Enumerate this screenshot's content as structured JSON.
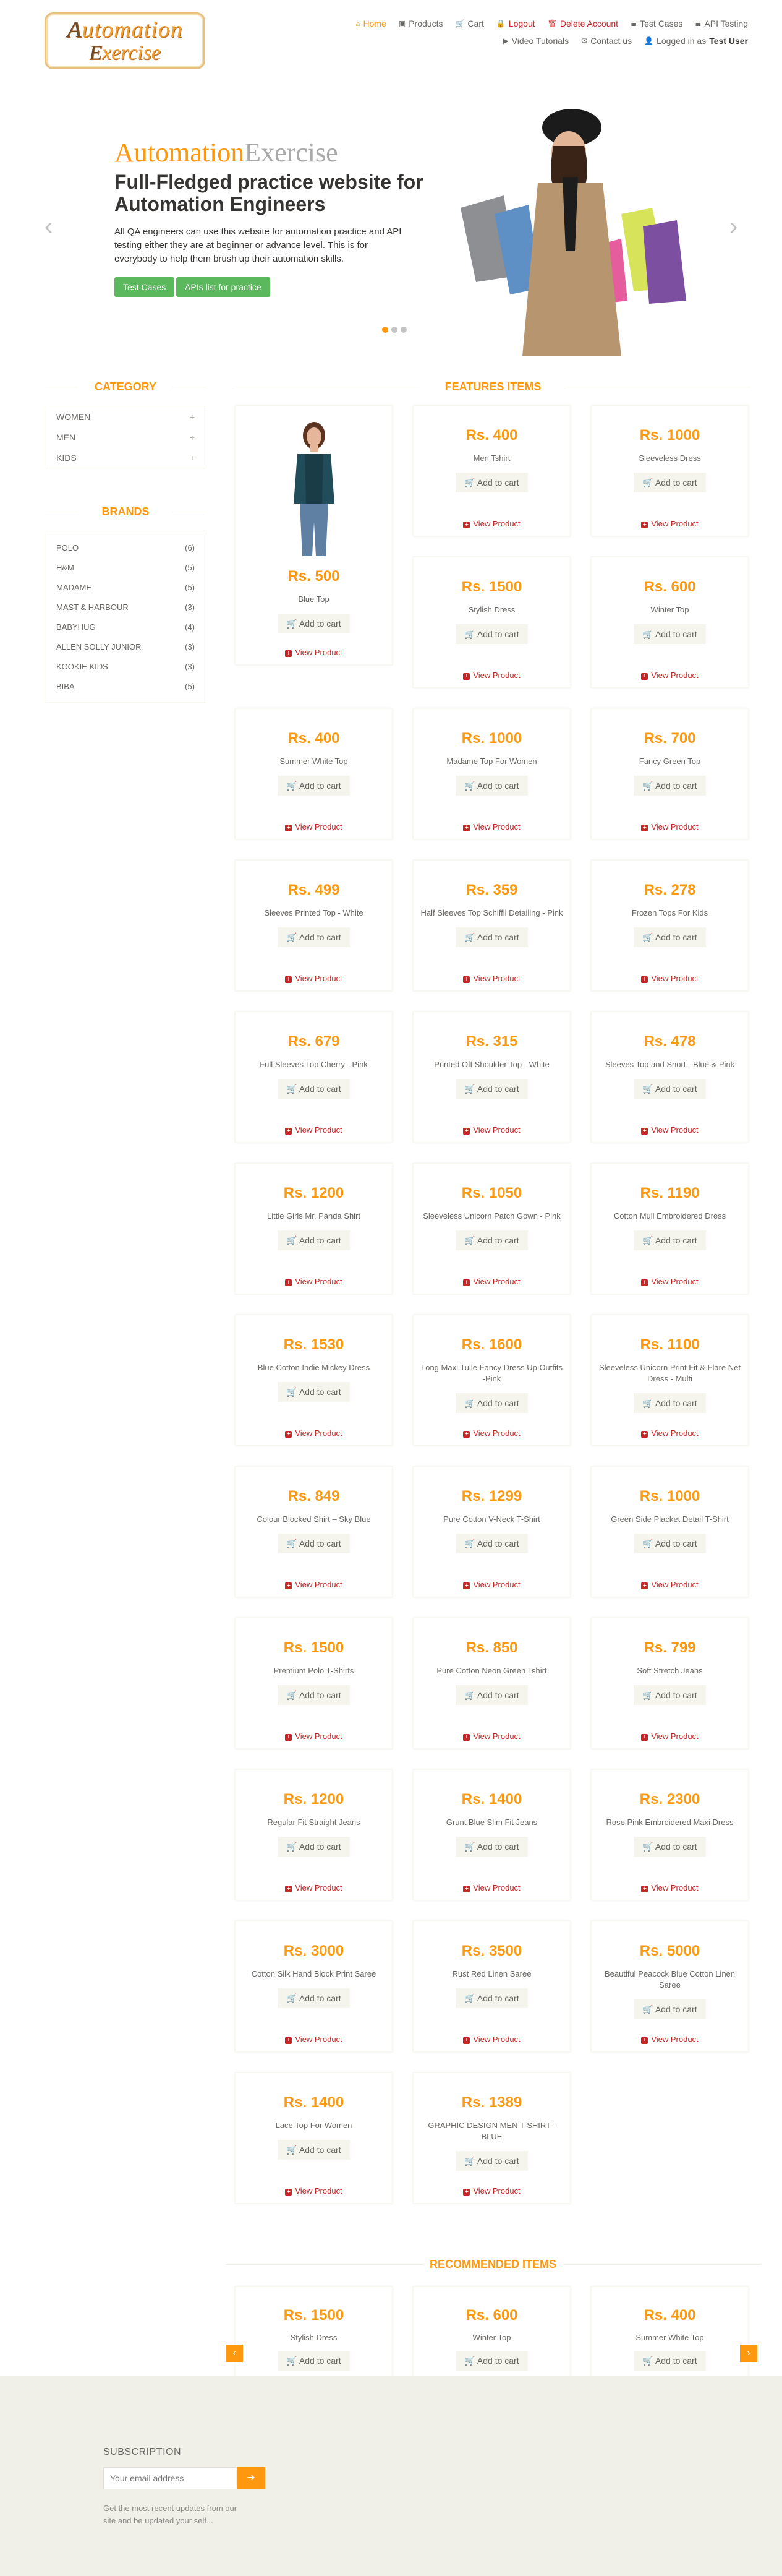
{
  "logo": {
    "line1_a": "Automation",
    "line2_a": "Exercise"
  },
  "nav": [
    {
      "label": "Home",
      "icon": "home-icon",
      "glyph": "⌂",
      "style": "active"
    },
    {
      "label": "Products",
      "icon": "products-icon",
      "glyph": "▣",
      "style": ""
    },
    {
      "label": "Cart",
      "icon": "cart-icon",
      "glyph": "🛒",
      "style": ""
    },
    {
      "label": "Logout",
      "icon": "lock-icon",
      "glyph": "🔒",
      "style": "danger"
    },
    {
      "label": "Delete Account",
      "icon": "trash-icon",
      "glyph": "🗑",
      "style": "danger"
    },
    {
      "label": "Test Cases",
      "icon": "list-icon",
      "glyph": "≣",
      "style": ""
    },
    {
      "label": "API Testing",
      "icon": "list-icon",
      "glyph": "≣",
      "style": ""
    },
    {
      "label": "Video Tutorials",
      "icon": "youtube-icon",
      "glyph": "▶",
      "style": ""
    },
    {
      "label": "Contact us",
      "icon": "envelope-icon",
      "glyph": "✉",
      "style": ""
    }
  ],
  "logged_in": {
    "prefix": "Logged in as",
    "user": "Test User"
  },
  "slider": {
    "brand_a": "Automation",
    "brand_b": "Exercise",
    "headline": "Full-Fledged practice website for Automation Engineers",
    "text": "All QA engineers can use this website for automation practice and API testing either they are at beginner or advance level. This is for everybody to help them brush up their automation skills.",
    "btn_test_cases": "Test Cases",
    "btn_apis": "APIs list for practice",
    "prev": "‹",
    "next": "›"
  },
  "category": {
    "title": "CATEGORY",
    "items": [
      "WOMEN",
      "MEN",
      "KIDS"
    ]
  },
  "brands": {
    "title": "BRANDS",
    "items": [
      {
        "name": "POLO",
        "count": "(6)"
      },
      {
        "name": "H&M",
        "count": "(5)"
      },
      {
        "name": "MADAME",
        "count": "(5)"
      },
      {
        "name": "MAST & HARBOUR",
        "count": "(3)"
      },
      {
        "name": "BABYHUG",
        "count": "(4)"
      },
      {
        "name": "ALLEN SOLLY JUNIOR",
        "count": "(3)"
      },
      {
        "name": "KOOKIE KIDS",
        "count": "(3)"
      },
      {
        "name": "BIBA",
        "count": "(5)"
      }
    ]
  },
  "features": {
    "title": "FEATURES ITEMS",
    "add_label": "🛒 Add to cart",
    "view_label": "View Product",
    "products": [
      {
        "price": "Rs. 500",
        "name": "Blue Top"
      },
      {
        "price": "Rs. 400",
        "name": "Men Tshirt"
      },
      {
        "price": "Rs. 1000",
        "name": "Sleeveless Dress"
      },
      {
        "price": "Rs. 1500",
        "name": "Stylish Dress"
      },
      {
        "price": "Rs. 600",
        "name": "Winter Top"
      },
      {
        "price": "Rs. 400",
        "name": "Summer White Top"
      },
      {
        "price": "Rs. 1000",
        "name": "Madame Top For Women"
      },
      {
        "price": "Rs. 700",
        "name": "Fancy Green Top"
      },
      {
        "price": "Rs. 499",
        "name": "Sleeves Printed Top - White"
      },
      {
        "price": "Rs. 359",
        "name": "Half Sleeves Top Schiffli Detailing - Pink"
      },
      {
        "price": "Rs. 278",
        "name": "Frozen Tops For Kids"
      },
      {
        "price": "Rs. 679",
        "name": "Full Sleeves Top Cherry - Pink"
      },
      {
        "price": "Rs. 315",
        "name": "Printed Off Shoulder Top - White"
      },
      {
        "price": "Rs. 478",
        "name": "Sleeves Top and Short - Blue & Pink"
      },
      {
        "price": "Rs. 1200",
        "name": "Little Girls Mr. Panda Shirt"
      },
      {
        "price": "Rs. 1050",
        "name": "Sleeveless Unicorn Patch Gown - Pink"
      },
      {
        "price": "Rs. 1190",
        "name": "Cotton Mull Embroidered Dress"
      },
      {
        "price": "Rs. 1530",
        "name": "Blue Cotton Indie Mickey Dress"
      },
      {
        "price": "Rs. 1600",
        "name": "Long Maxi Tulle Fancy Dress Up Outfits -Pink"
      },
      {
        "price": "Rs. 1100",
        "name": "Sleeveless Unicorn Print Fit & Flare Net Dress - Multi"
      },
      {
        "price": "Rs. 849",
        "name": "Colour Blocked Shirt – Sky Blue"
      },
      {
        "price": "Rs. 1299",
        "name": "Pure Cotton V-Neck T-Shirt"
      },
      {
        "price": "Rs. 1000",
        "name": "Green Side Placket Detail T-Shirt"
      },
      {
        "price": "Rs. 1500",
        "name": "Premium Polo T-Shirts"
      },
      {
        "price": "Rs. 850",
        "name": "Pure Cotton Neon Green Tshirt"
      },
      {
        "price": "Rs. 799",
        "name": "Soft Stretch Jeans"
      },
      {
        "price": "Rs. 1200",
        "name": "Regular Fit Straight Jeans"
      },
      {
        "price": "Rs. 1400",
        "name": "Grunt Blue Slim Fit Jeans"
      },
      {
        "price": "Rs. 2300",
        "name": "Rose Pink Embroidered Maxi Dress"
      },
      {
        "price": "Rs. 3000",
        "name": "Cotton Silk Hand Block Print Saree"
      },
      {
        "price": "Rs. 3500",
        "name": "Rust Red Linen Saree"
      },
      {
        "price": "Rs. 5000",
        "name": "Beautiful Peacock Blue Cotton Linen Saree"
      },
      {
        "price": "Rs. 1400",
        "name": "Lace Top For Women"
      },
      {
        "price": "Rs. 1389",
        "name": "GRAPHIC DESIGN MEN T SHIRT - BLUE"
      }
    ]
  },
  "recommended": {
    "title": "RECOMMENDED ITEMS",
    "items": [
      {
        "price": "Rs. 1500",
        "name": "Stylish Dress"
      },
      {
        "price": "Rs. 600",
        "name": "Winter Top"
      },
      {
        "price": "Rs. 400",
        "name": "Summer White Top"
      }
    ],
    "prev": "‹",
    "next": "›"
  },
  "footer": {
    "subscription": "SUBSCRIPTION",
    "placeholder": "Your email address",
    "note": "Get the most recent updates from our site and be updated your self..."
  },
  "colors": {
    "accent": "#fe980f",
    "danger": "#c62828",
    "green": "#5cb85c",
    "footer_bg": "#f0f0e9"
  }
}
